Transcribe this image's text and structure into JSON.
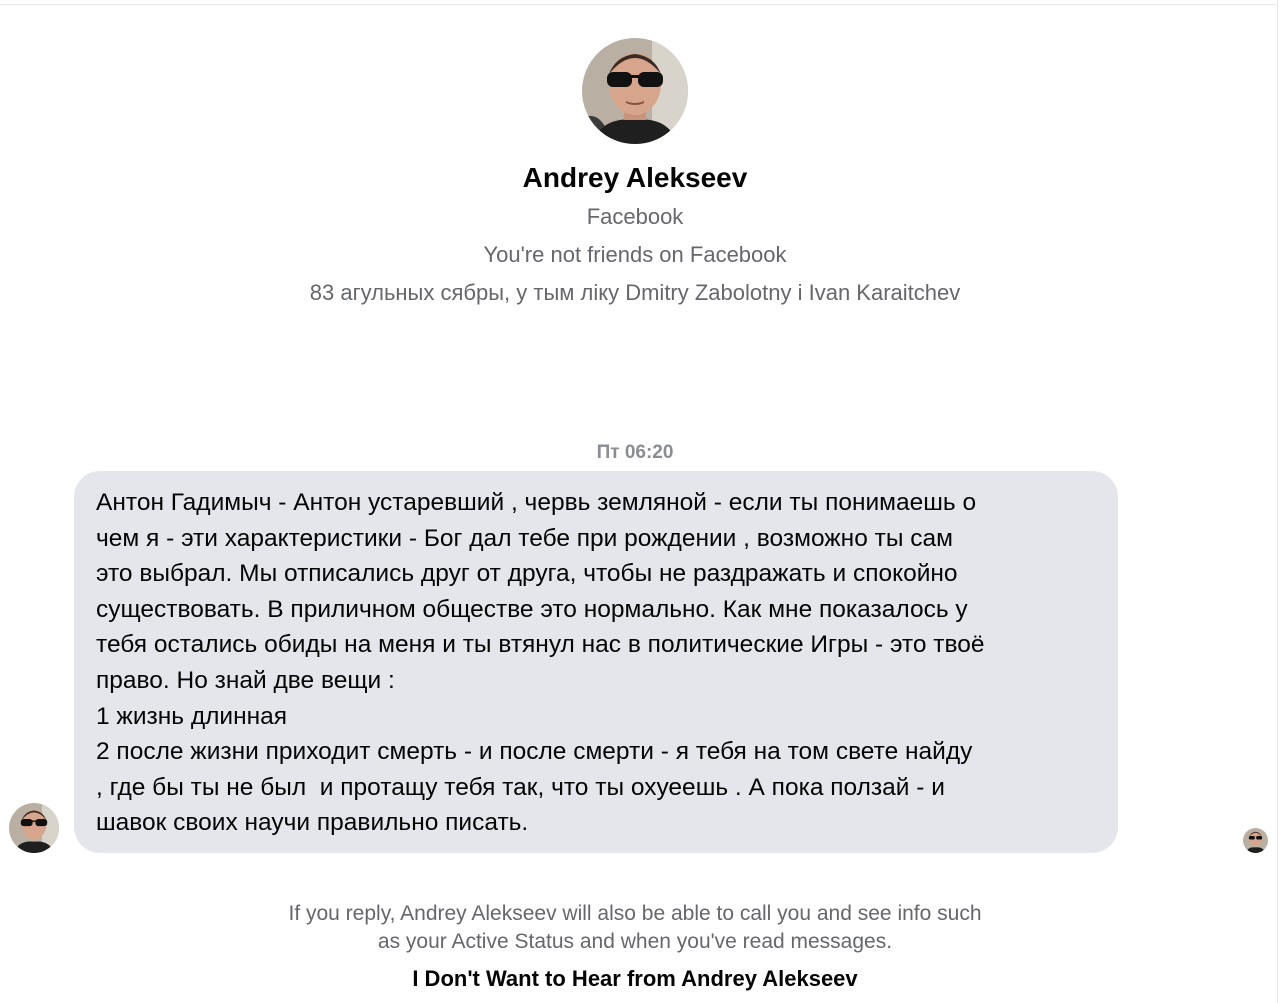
{
  "profile": {
    "name": "Andrey Alekseev",
    "platform": "Facebook",
    "friend_status": "You're not friends on Facebook",
    "mutual_friends": "83 агульных сябры, у тым ліку Dmitry Zabolotny і Ivan Karaitchev"
  },
  "conversation": {
    "timestamp": "Пт 06:20",
    "message": {
      "text": "Антон Гадимыч - Антон устаревший , червь земляной - если ты понимаешь о\nчем я - эти характеристики - Бог дал тебе при рождении , возможно ты сам\nэто выбрал. Мы отписались друг от друга, чтобы не раздражать и спокойно\nсуществовать. В приличном обществе это нормально. Как мне показалось у\nтебя остались обиды на меня и ты втянул нас в политические Игры - это твоё\nправо. Но знай две вещи :\n1 жизнь длинная\n2 после жизни приходит смерть - и после смерти - я тебя на том свете найду\n, где бы ты не был  и протащу тебя так, что ты охуеешь . А пока ползай - и\nшавок своих научи правильно писать."
    }
  },
  "footer": {
    "notice_line1": "If you reply, Andrey Alekseev will also be able to call you and see info such",
    "notice_line2": "as your Active Status and when you've read messages.",
    "block_link": "I Don't Want to Hear from Andrey Alekseev"
  },
  "icons": {
    "avatar": "profile-photo-icon",
    "read_receipt": "seen-avatar-icon"
  },
  "colors": {
    "bubble": "#e4e6eb",
    "secondary_text": "#65676b",
    "timestamp": "#8a8d91"
  }
}
